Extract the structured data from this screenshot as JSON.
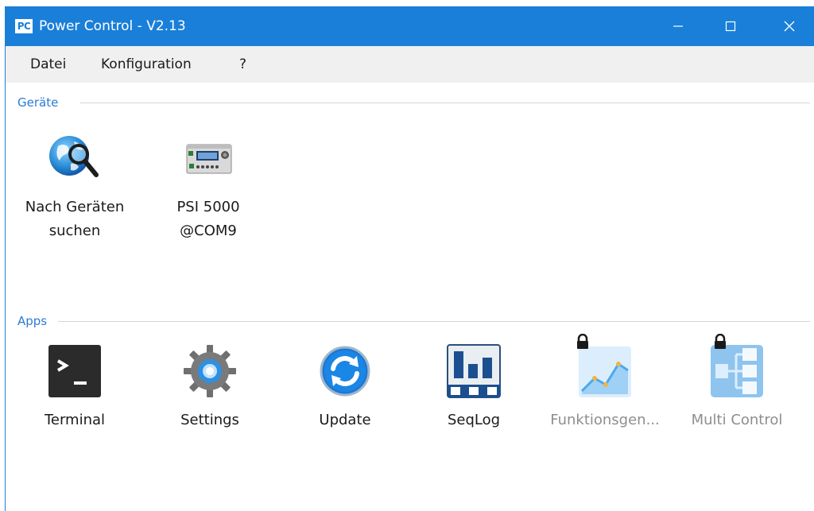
{
  "window": {
    "title": "Power Control - V2.13",
    "logo_text": "PC",
    "accent_color": "#1a7fd8"
  },
  "menu": {
    "items": [
      {
        "label": "Datei"
      },
      {
        "label": "Konfiguration"
      },
      {
        "label": "?"
      }
    ]
  },
  "devices": {
    "title": "Geräte",
    "items": [
      {
        "line1": "Nach Geräten",
        "line2": "suchen",
        "icon": "globe-search-icon"
      },
      {
        "line1": "PSI 5000",
        "line2": "@COM9",
        "icon": "power-supply-icon"
      }
    ]
  },
  "apps": {
    "title": "Apps",
    "items": [
      {
        "label": "Terminal",
        "icon": "terminal-icon",
        "locked": false
      },
      {
        "label": "Settings",
        "icon": "gear-icon",
        "locked": false
      },
      {
        "label": "Update",
        "icon": "refresh-icon",
        "locked": false
      },
      {
        "label": "SeqLog",
        "icon": "seqlog-icon",
        "locked": false
      },
      {
        "label": "Funktionsgen...",
        "icon": "function-generator-icon",
        "locked": true
      },
      {
        "label": "Multi Control",
        "icon": "multi-control-icon",
        "locked": true
      }
    ]
  }
}
